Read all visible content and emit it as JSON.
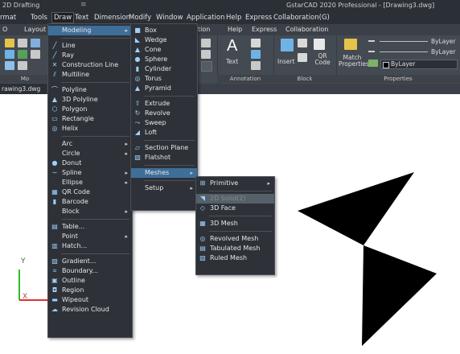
{
  "window": {
    "workspace": "2D Drafting",
    "quick_access": "≡",
    "title": "GstarCAD 2020 Professional - [Drawing3.dwg]"
  },
  "menubar": {
    "items": [
      "rmat",
      "Tools",
      "Draw",
      "Text",
      "Dimension",
      "Modify",
      "Window",
      "Application",
      "Help",
      "Express",
      "Collaboration(G)"
    ]
  },
  "ribbon_tabs": [
    "O",
    "Layout",
    "tion",
    "Help",
    "Express",
    "Collaboration"
  ],
  "ribbon": {
    "groups": {
      "mo_label": "Mo",
      "text_button": "Text",
      "annotation_label": "Annotation",
      "insert_button": "Insert",
      "qr_code_button": "QR Code",
      "block_label": "Block",
      "match_properties_button": "Match Properties",
      "properties_label": "Properties",
      "bylayer_1": "ByLayer",
      "bylayer_2": "ByLayer",
      "bylayer_3": "ByLayer"
    }
  },
  "doc_tab": "rawing3.dwg",
  "draw_menu": {
    "items": [
      {
        "label": "Modeling",
        "icon": "",
        "arrow": true,
        "highlight": true
      },
      {
        "sep": true
      },
      {
        "label": "Line",
        "icon": "line-icon"
      },
      {
        "label": "Ray",
        "icon": "ray-icon"
      },
      {
        "label": "Construction Line",
        "icon": "construction-line-icon"
      },
      {
        "label": "Multiline",
        "icon": "multiline-icon"
      },
      {
        "sep": true
      },
      {
        "label": "Polyline",
        "icon": "polyline-icon"
      },
      {
        "label": "3D Polyline",
        "icon": "3d-polyline-icon"
      },
      {
        "label": "Polygon",
        "icon": "polygon-icon"
      },
      {
        "label": "Rectangle",
        "icon": "rectangle-icon"
      },
      {
        "label": "Helix",
        "icon": "helix-icon"
      },
      {
        "sep": true
      },
      {
        "label": "Arc",
        "icon": "",
        "arrow": true
      },
      {
        "label": "Circle",
        "icon": "",
        "arrow": true
      },
      {
        "label": "Donut",
        "icon": "donut-icon"
      },
      {
        "label": "Spline",
        "icon": "spline-icon",
        "arrow": true
      },
      {
        "label": "Ellipse",
        "icon": "",
        "arrow": true
      },
      {
        "label": "QR Code",
        "icon": "qr-code-icon"
      },
      {
        "label": "Barcode",
        "icon": "barcode-icon"
      },
      {
        "label": "Block",
        "icon": "",
        "arrow": true
      },
      {
        "sep": true
      },
      {
        "label": "Table...",
        "icon": "table-icon"
      },
      {
        "label": "Point",
        "icon": "",
        "arrow": true
      },
      {
        "label": "Hatch...",
        "icon": "hatch-icon"
      },
      {
        "sep": true
      },
      {
        "label": "Gradient...",
        "icon": "gradient-icon"
      },
      {
        "label": "Boundary...",
        "icon": "boundary-icon"
      },
      {
        "label": "Outline",
        "icon": "outline-icon"
      },
      {
        "label": "Region",
        "icon": "region-icon"
      },
      {
        "label": "Wipeout",
        "icon": "wipeout-icon"
      },
      {
        "label": "Revision Cloud",
        "icon": "revision-cloud-icon"
      }
    ]
  },
  "modeling_menu": {
    "items": [
      {
        "label": "Box",
        "icon": "box-icon"
      },
      {
        "label": "Wedge",
        "icon": "wedge-icon"
      },
      {
        "label": "Cone",
        "icon": "cone-icon"
      },
      {
        "label": "Sphere",
        "icon": "sphere-icon"
      },
      {
        "label": "Cylinder",
        "icon": "cylinder-icon"
      },
      {
        "label": "Torus",
        "icon": "torus-icon"
      },
      {
        "label": "Pyramid",
        "icon": "pyramid-icon"
      },
      {
        "sep": true
      },
      {
        "label": "Extrude",
        "icon": "extrude-icon"
      },
      {
        "label": "Revolve",
        "icon": "revolve-icon"
      },
      {
        "label": "Sweep",
        "icon": "sweep-icon"
      },
      {
        "label": "Loft",
        "icon": "loft-icon"
      },
      {
        "sep": true
      },
      {
        "label": "Section Plane",
        "icon": "section-plane-icon"
      },
      {
        "label": "Flatshot",
        "icon": "flatshot-icon"
      },
      {
        "sep": true
      },
      {
        "label": "Meshes",
        "icon": "",
        "arrow": true,
        "highlight": true
      },
      {
        "sep": true
      },
      {
        "label": "Setup",
        "icon": "",
        "arrow": true
      }
    ]
  },
  "meshes_menu": {
    "items": [
      {
        "label": "Primitive",
        "icon": "primitive-icon",
        "arrow": true
      },
      {
        "sep": true
      },
      {
        "label": "2D Solid(2)",
        "icon": "2d-solid-icon",
        "highlight": true,
        "disabled": true
      },
      {
        "label": "3D Face",
        "icon": "3d-face-icon"
      },
      {
        "sep": true
      },
      {
        "label": "3D Mesh",
        "icon": "3d-mesh-icon"
      },
      {
        "sep": true
      },
      {
        "label": "Revolved Mesh",
        "icon": "revolved-mesh-icon"
      },
      {
        "label": "Tabulated Mesh",
        "icon": "tabulated-mesh-icon"
      },
      {
        "label": "Ruled Mesh",
        "icon": "ruled-mesh-icon"
      }
    ]
  },
  "ucs": {
    "y_label": "Y",
    "x_label": "X"
  },
  "colors": {
    "accent_highlight": "#3f6e99",
    "ucs_y": "#2bbd2b",
    "ucs_x": "#e03030"
  }
}
